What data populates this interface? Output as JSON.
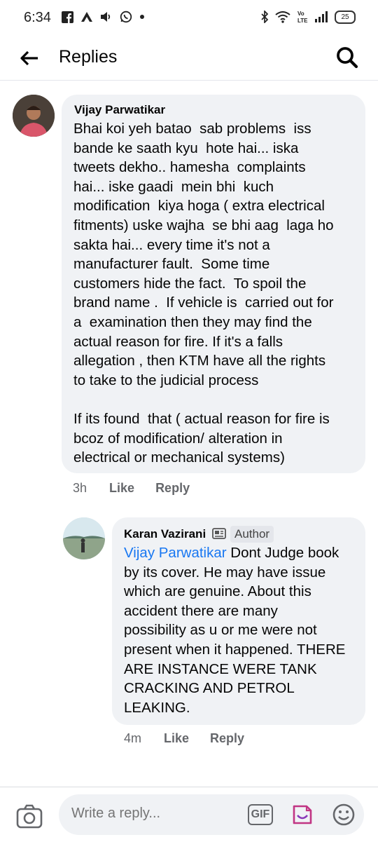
{
  "status_bar": {
    "time": "6:34",
    "battery": "25"
  },
  "header": {
    "title": "Replies"
  },
  "comments": [
    {
      "author": "Vijay Parwatikar",
      "text": "Bhai koi yeh batao  sab problems  iss\nbande ke saath kyu  hote hai... iska\ntweets dekho.. hamesha  complaints\nhai... iske gaadi  mein bhi  kuch\nmodification  kiya hoga ( extra electrical\nfitments) uske wajha  se bhi aag  laga ho\nsakta hai... every time it's not a\nmanufacturer fault.  Some time\ncustomers hide the fact.  To spoil the\nbrand name .  If vehicle is  carried out for\na  examination then they may find the\nactual reason for fire. If it's a falls\nallegation , then KTM have all the rights\nto take to the judicial process\n\nIf its found  that ( actual reason for fire is\nbcoz of modification/ alteration in\nelectrical or mechanical systems)",
      "time": "3h",
      "like": "Like",
      "reply": "Reply"
    },
    {
      "author": "Karan Vazirani",
      "badge": "Author",
      "mention": "Vijay Parwatikar",
      "text": " Dont Judge book\nby its cover. He may have issue\nwhich are genuine. About this\naccident there are many\npossibility as u or me were not\npresent when it happened. THERE\nARE INSTANCE WERE TANK\nCRACKING AND PETROL\nLEAKING.",
      "time": "4m",
      "like": "Like",
      "reply": "Reply"
    }
  ],
  "footer": {
    "placeholder": "Write a reply...",
    "gif_label": "GIF"
  },
  "colors": {
    "bubble": "#f0f2f5",
    "mention": "#1877f2",
    "meta": "#65676b"
  }
}
